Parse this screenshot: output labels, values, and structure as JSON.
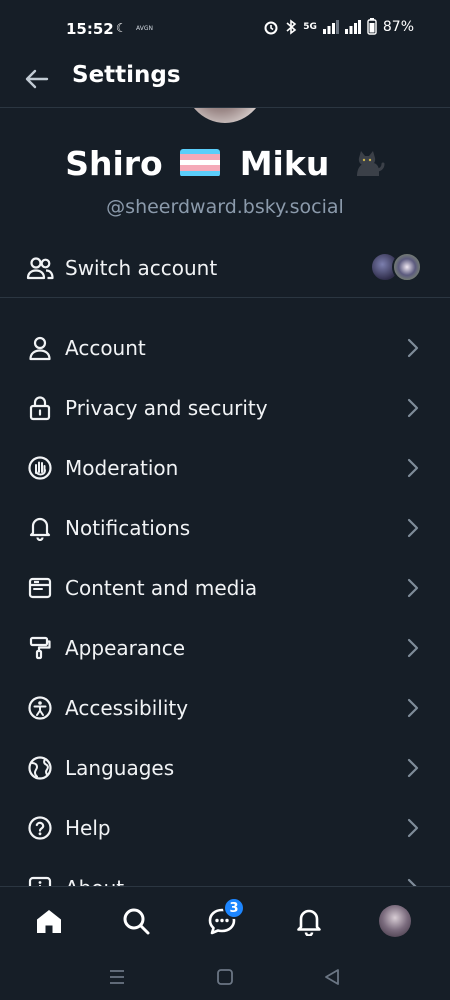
{
  "status_bar": {
    "time": "15:52",
    "small_logo": "AVGN",
    "battery": "87%",
    "network": "5G"
  },
  "header": {
    "title": "Settings"
  },
  "profile": {
    "name_first": "Shiro",
    "name_second": "Miku",
    "handle": "@sheerdward.bsky.social"
  },
  "switch_account": {
    "label": "Switch account"
  },
  "menu": [
    {
      "label": "Account",
      "icon": "person-icon"
    },
    {
      "label": "Privacy and security",
      "icon": "lock-icon"
    },
    {
      "label": "Moderation",
      "icon": "hand-icon"
    },
    {
      "label": "Notifications",
      "icon": "bell-icon"
    },
    {
      "label": "Content and media",
      "icon": "window-icon"
    },
    {
      "label": "Appearance",
      "icon": "paint-roller-icon"
    },
    {
      "label": "Accessibility",
      "icon": "accessibility-icon"
    },
    {
      "label": "Languages",
      "icon": "globe-icon"
    },
    {
      "label": "Help",
      "icon": "help-icon"
    },
    {
      "label": "About",
      "icon": "info-icon"
    }
  ],
  "tabbar": {
    "chat_badge": "3"
  },
  "colors": {
    "background": "#161e27",
    "text": "#f1f3f5",
    "muted": "#8b9aab",
    "divider": "#2b3641",
    "badge": "#1d86ff"
  }
}
